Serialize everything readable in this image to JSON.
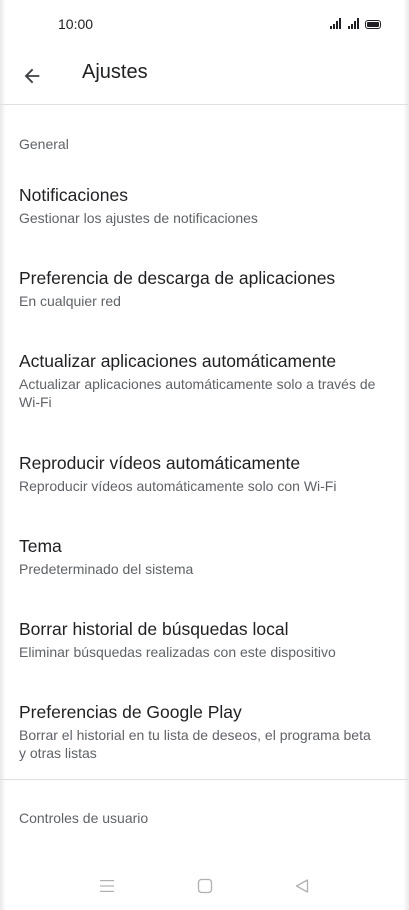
{
  "status_bar": {
    "time": "10:00"
  },
  "app_bar": {
    "title": "Ajustes"
  },
  "sections": {
    "general": "General",
    "user_controls": "Controles de usuario"
  },
  "settings": [
    {
      "title": "Notificaciones",
      "subtitle": "Gestionar los ajustes de notificaciones"
    },
    {
      "title": "Preferencia de descarga de aplicaciones",
      "subtitle": "En cualquier red"
    },
    {
      "title": "Actualizar aplicaciones automáticamente",
      "subtitle": "Actualizar aplicaciones automáticamente solo a través de Wi-Fi"
    },
    {
      "title": "Reproducir vídeos automáticamente",
      "subtitle": "Reproducir vídeos automáticamente solo con Wi-Fi"
    },
    {
      "title": "Tema",
      "subtitle": "Predeterminado del sistema"
    },
    {
      "title": "Borrar historial de búsquedas local",
      "subtitle": "Eliminar búsquedas realizadas con este dispositivo"
    },
    {
      "title": "Preferencias de Google Play",
      "subtitle": "Borrar el historial en tu lista de deseos, el programa beta y otras listas"
    }
  ],
  "icons": {
    "back": "arrow-back-icon",
    "signal": "cell-signal-icon",
    "battery": "battery-icon",
    "nav_menu": "menu-icon",
    "nav_home": "home-square-icon",
    "nav_back": "back-triangle-icon"
  },
  "colors": {
    "text_primary": "#202124",
    "text_secondary": "#5f6368",
    "divider": "#e0e0e0",
    "nav_icon": "#b0b0b0"
  }
}
